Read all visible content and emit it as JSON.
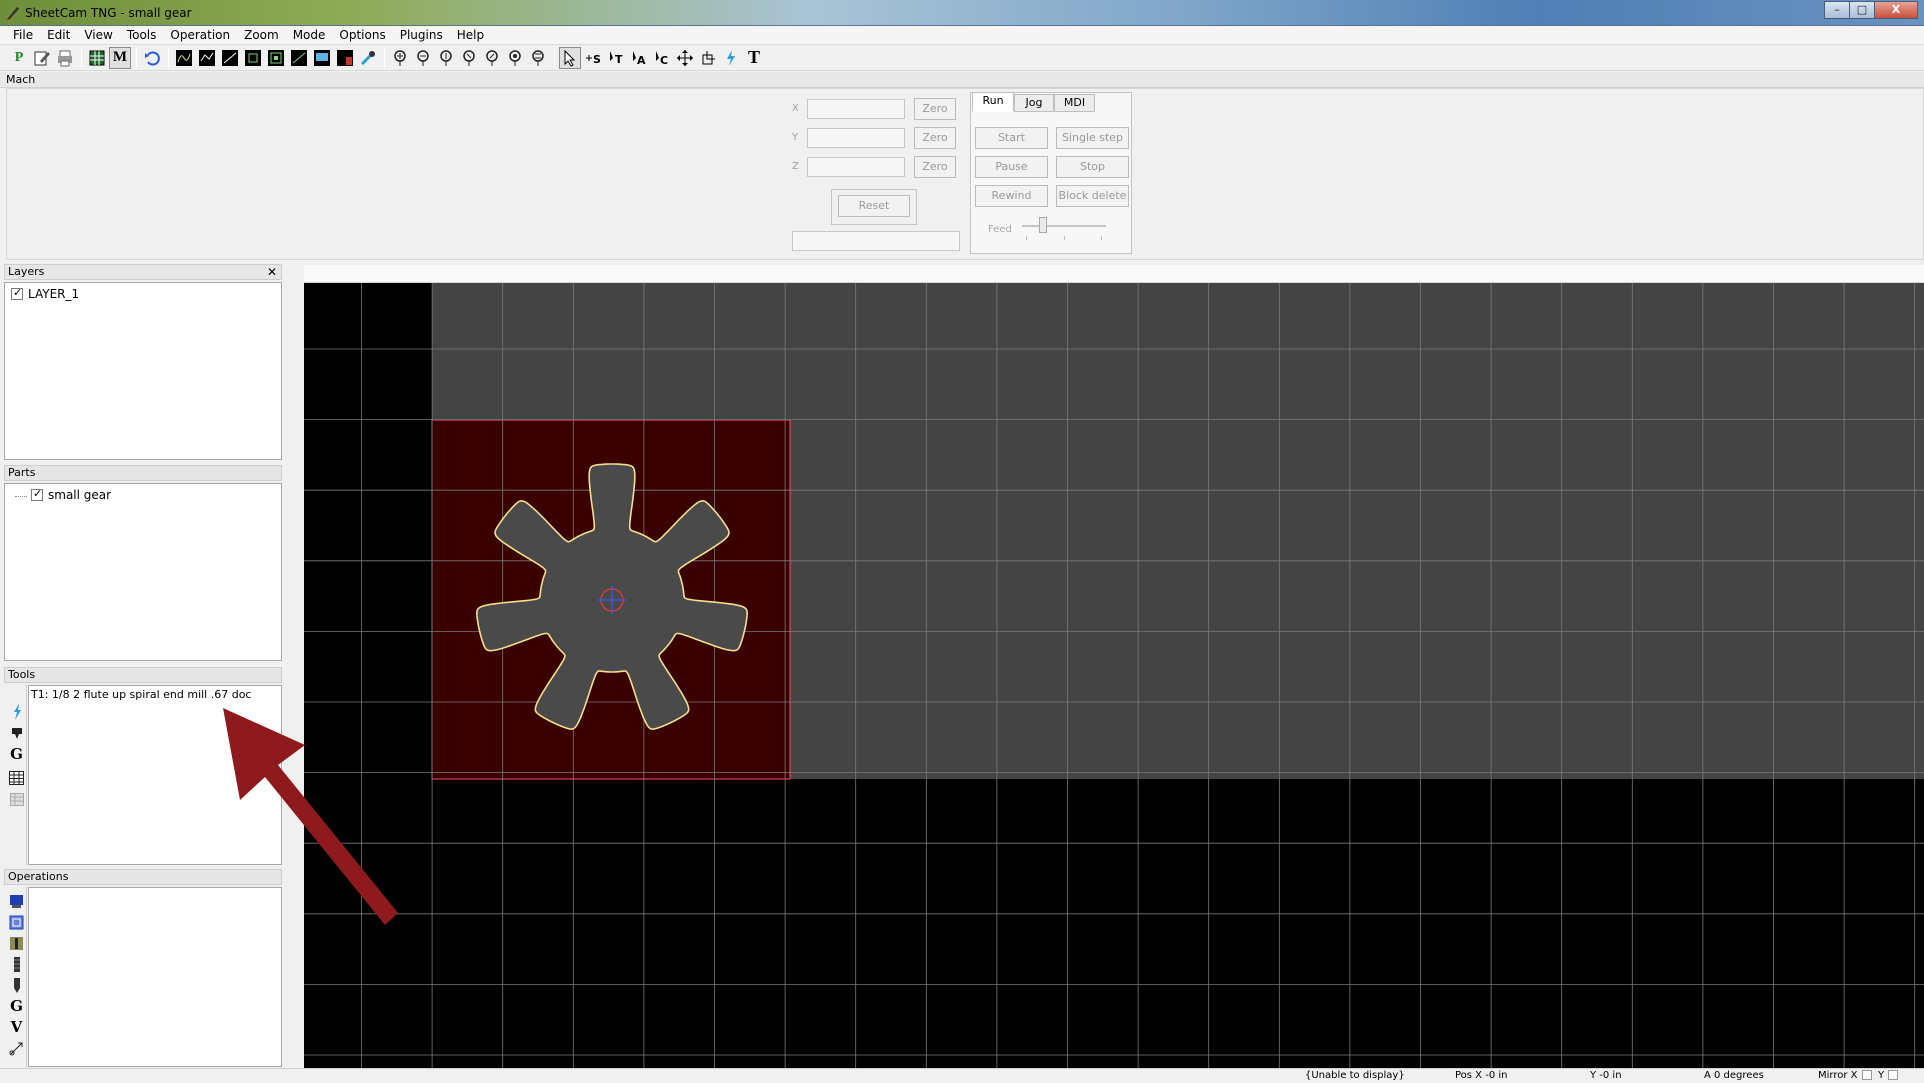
{
  "window": {
    "title": "SheetCam TNG - small gear",
    "min_label": "–",
    "max_label": "□",
    "close_label": "X"
  },
  "menu": [
    "File",
    "Edit",
    "View",
    "Tools",
    "Operation",
    "Zoom",
    "Mode",
    "Options",
    "Plugins",
    "Help"
  ],
  "toolbar": {
    "text_tool_label": "T",
    "m_label": "M",
    "p_label": "P"
  },
  "mach": {
    "header": "Mach",
    "axes": [
      {
        "label": "X",
        "zero": "Zero"
      },
      {
        "label": "Y",
        "zero": "Zero"
      },
      {
        "label": "Z",
        "zero": "Zero"
      }
    ],
    "reset": "Reset",
    "tabs": [
      "Run",
      "Jog",
      "MDI"
    ],
    "buttons": {
      "start": "Start",
      "single_step": "Single step",
      "pause": "Pause",
      "stop": "Stop",
      "rewind": "Rewind",
      "block_delete": "Block delete"
    },
    "feed_label": "Feed"
  },
  "layers": {
    "header": "Layers",
    "close": "✕",
    "items": [
      "LAYER_1"
    ]
  },
  "parts": {
    "header": "Parts",
    "items": [
      "small gear"
    ]
  },
  "tools": {
    "header": "Tools",
    "items": [
      "T1: 1/8 2 flute up spiral end mill .67 doc"
    ],
    "g_label": "G"
  },
  "operations": {
    "header": "Operations",
    "g_label": "G",
    "v_label": "V"
  },
  "colors": {
    "stock": "#3a0000",
    "stock_edge": "#ff4d6d",
    "gear_fill": "#4a4a4a",
    "gear_edge": "#f3e08a",
    "grid": "#7a7a7a",
    "plate": "#444444",
    "arrow": "#8f1a1d"
  },
  "status": {
    "message": "{Unable to display}",
    "pos_x": "Pos X -0 in",
    "pos_y": "Y -0 in",
    "angle": "A 0 degrees",
    "mirror": "Mirror X",
    "mirror_y": "Y"
  }
}
